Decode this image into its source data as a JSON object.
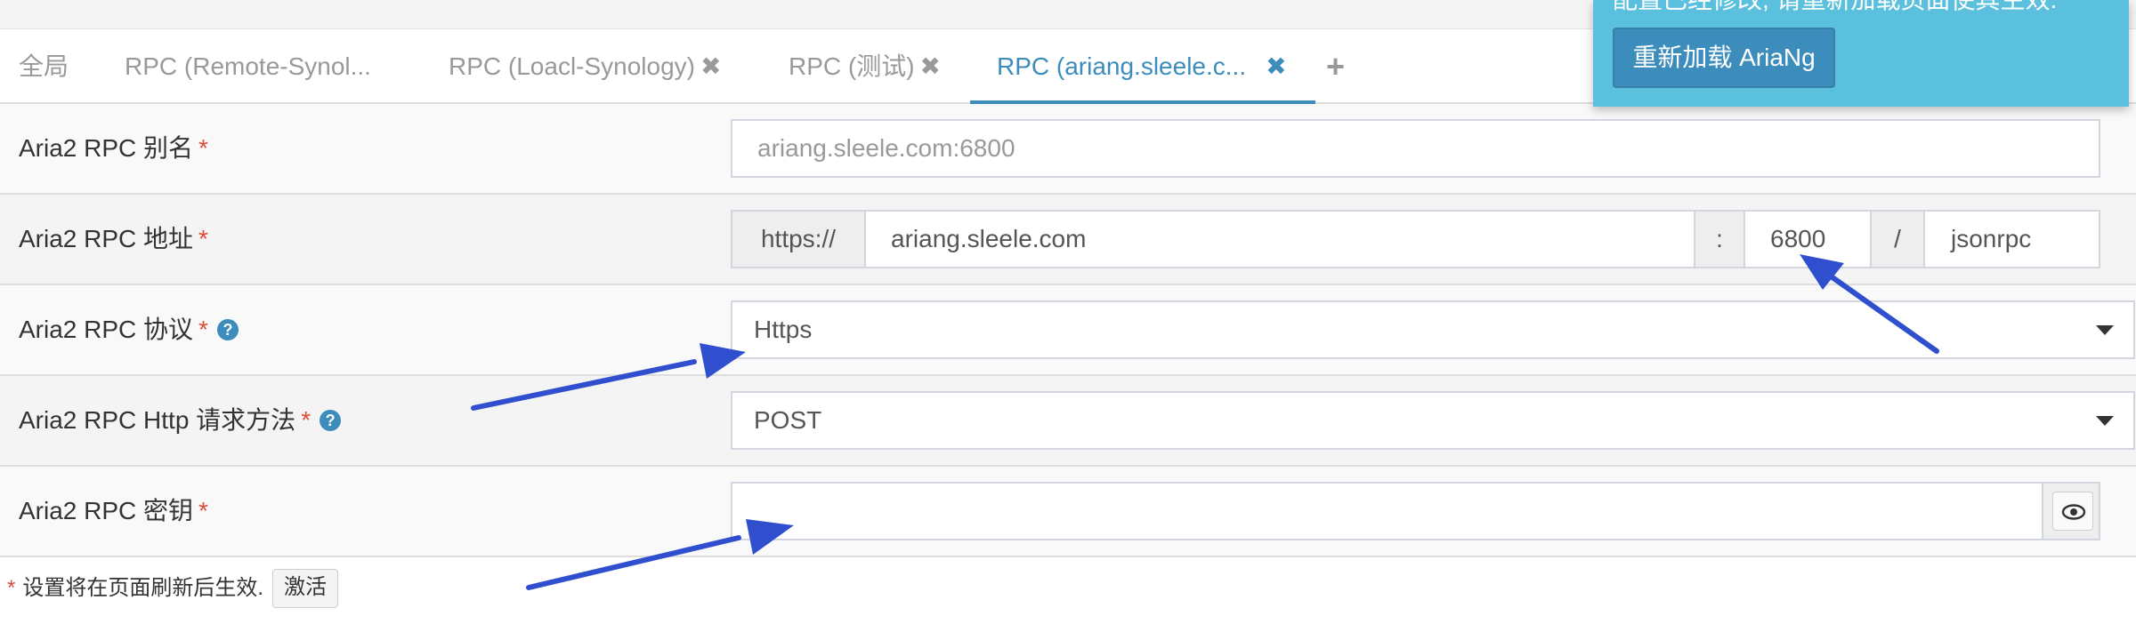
{
  "tabs": [
    {
      "label": "全局",
      "closable": false,
      "active": false
    },
    {
      "label": "RPC (Remote-Synol...",
      "closable": false,
      "active": false
    },
    {
      "label": "RPC (Loacl-Synology)",
      "closable": true,
      "active": false
    },
    {
      "label": "RPC (测试)",
      "closable": true,
      "active": false
    },
    {
      "label": "RPC (ariang.sleele.c...",
      "closable": true,
      "active": true
    }
  ],
  "tab_close_glyph": "✖",
  "tab_add_glyph": "+",
  "form": {
    "alias": {
      "label": "Aria2 RPC 别名",
      "placeholder": "ariang.sleele.com:6800"
    },
    "address": {
      "label": "Aria2 RPC 地址",
      "protocol_prefix": "https://",
      "host": "ariang.sleele.com",
      "colon": ":",
      "port": "6800",
      "slash": "/",
      "interface": "jsonrpc"
    },
    "protocol": {
      "label": "Aria2 RPC 协议",
      "value": "Https"
    },
    "method": {
      "label": "Aria2 RPC Http 请求方法",
      "value": "POST"
    },
    "secret": {
      "label": "Aria2 RPC 密钥",
      "value": ""
    },
    "required_mark": "*",
    "help_glyph": "?"
  },
  "footer": {
    "mark": "*",
    "note": "设置将在页面刷新后生效.",
    "activate_label": "激活"
  },
  "notification": {
    "message": "配置已经修改, 请重新加载页面使其生效.",
    "reload_label": "重新加载 AriaNg"
  },
  "colors": {
    "accent": "#3c8dbc",
    "notify_bg": "#5bc0de",
    "required": "#dd4b39",
    "arrow": "#2f4fcf"
  },
  "icons": {
    "eye": "eye-icon",
    "help": "question-circle-icon",
    "close": "close-icon",
    "add": "plus-icon",
    "caret": "caret-down-icon"
  }
}
